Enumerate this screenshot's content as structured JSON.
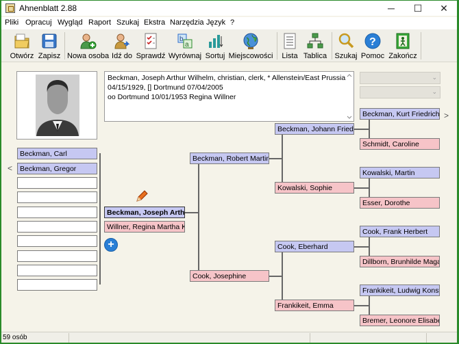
{
  "window": {
    "title": "Ahnenblatt 2.88",
    "controls": {
      "minimize": "─",
      "maximize": "☐",
      "close": "✕"
    }
  },
  "menu": [
    "Pliki",
    "Opracuj",
    "Wygląd",
    "Raport",
    "Szukaj",
    "Ekstra",
    "Narzędzia",
    "Język",
    "?"
  ],
  "toolbar": {
    "buttons": [
      {
        "label": "Otwórz",
        "icon": "open-folder-icon"
      },
      {
        "label": "Zapisz",
        "icon": "save-disk-icon"
      },
      {
        "label": "Nowa osoba",
        "icon": "new-person-icon"
      },
      {
        "label": "Idź do",
        "icon": "go-to-person-icon"
      },
      {
        "label": "Sprawdź",
        "icon": "check-list-icon"
      },
      {
        "label": "Wyrównaj",
        "icon": "align-icon"
      },
      {
        "label": "Sortuj",
        "icon": "sort-icon"
      },
      {
        "label": "Miejscowości",
        "icon": "globe-icon"
      },
      {
        "label": "Lista",
        "icon": "list-icon"
      },
      {
        "label": "Tablica",
        "icon": "tree-table-icon"
      },
      {
        "label": "Szukaj",
        "icon": "search-icon"
      },
      {
        "label": "Pomoc",
        "icon": "help-icon"
      },
      {
        "label": "Zakończ",
        "icon": "exit-icon"
      }
    ]
  },
  "info": {
    "line1": "Beckman, Joseph Arthur Wilhelm, christian, clerk, * Allenstein/East Prussia",
    "line2": "04/15/1929, [] Dortmund 07/04/2005",
    "line3": "oo Dortmund 10/01/1953 Regina Willner"
  },
  "children": [
    "Beckman, Carl",
    "Beckman, Gregor",
    "",
    "",
    "",
    "",
    "",
    "",
    "",
    ""
  ],
  "person": {
    "name": "Beckman, Joseph Arthur",
    "spouse": "Willner, Regina Martha K"
  },
  "parents": {
    "father": "Beckman, Robert Martin",
    "mother": "Cook, Josephine"
  },
  "grandparents": {
    "ff": "Beckman, Johann Friedrich",
    "fm": "Kowalski, Sophie",
    "mf": "Cook, Eberhard",
    "mm": "Frankikeit, Emma"
  },
  "great_grandparents": [
    "Beckman, Kurt Friedrich",
    "Schmidt, Caroline",
    "Kowalski, Martin",
    "Esser, Dorothe",
    "Cook, Frank Herbert",
    "Dillborn, Brunhilde Maga",
    "Frankikeit, Ludwig Konsta",
    "Bremer, Leonore Elisabet"
  ],
  "nav": {
    "left_arrow": "<",
    "right_arrow": ">"
  },
  "status": {
    "count": "59 osób"
  },
  "colors": {
    "male": "#c6c8f2",
    "female": "#f6c4c8",
    "accent": "#2a8a2a"
  }
}
